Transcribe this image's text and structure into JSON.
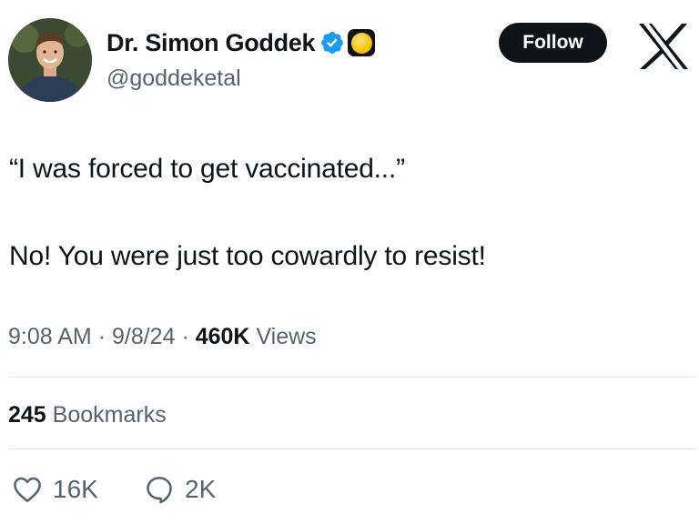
{
  "author": {
    "display_name": "Dr. Simon Goddek",
    "handle": "@goddeketal",
    "verified": true
  },
  "header": {
    "follow_label": "Follow",
    "logo_icon": "x-logo-icon"
  },
  "tweet": {
    "line1": "“I was forced to get vaccinated...”",
    "line2": "No! You were just too cowardly to resist!"
  },
  "meta": {
    "time": "9:08 AM",
    "separator": "·",
    "date": "9/8/24",
    "views_count": "460K",
    "views_label": "Views"
  },
  "engagement": {
    "bookmarks_count": "245",
    "bookmarks_label": "Bookmarks",
    "likes": "16K",
    "replies": "2K"
  },
  "colors": {
    "text": "#0f1419",
    "secondary": "#536471",
    "verified_blue": "#1d9bf0",
    "divider": "#e6e9eb"
  }
}
